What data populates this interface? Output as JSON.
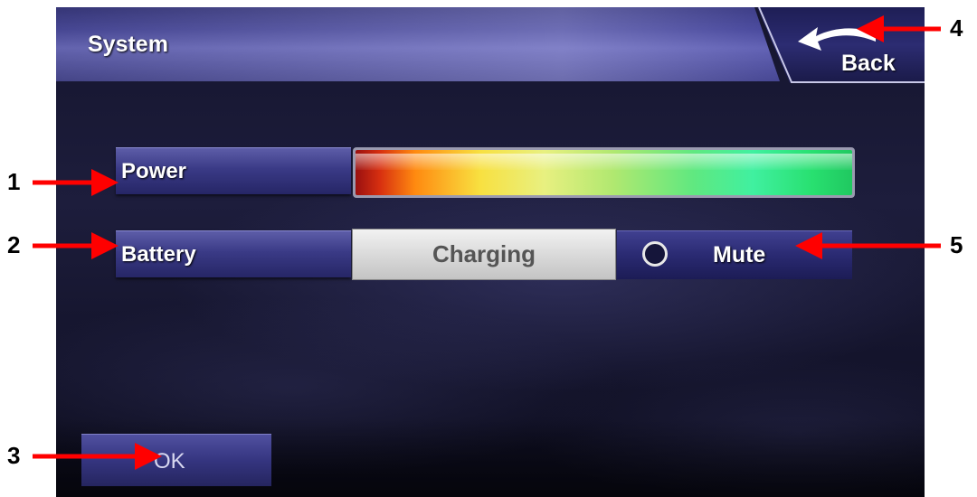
{
  "header": {
    "title": "System",
    "back_label": "Back"
  },
  "rows": [
    {
      "label": "Power"
    },
    {
      "label": "Battery"
    }
  ],
  "power": {
    "level_fraction": 1.0
  },
  "battery": {
    "status_button": "Charging",
    "mute_label": "Mute",
    "mute_selected": false
  },
  "footer": {
    "ok_label": "OK"
  },
  "callouts": [
    "1",
    "2",
    "3",
    "4",
    "5"
  ],
  "colors": {
    "arrow": "#ff0000",
    "panel": "#1d1d3c",
    "button": "#3a3a86"
  }
}
